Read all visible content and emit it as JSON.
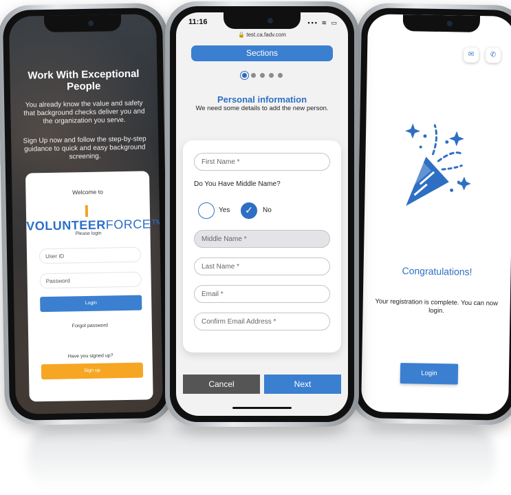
{
  "phone1": {
    "headline": "Work With Exceptional People",
    "para1": "You already know the value and safety that background checks deliver you and the organization you serve.",
    "para2": "Sign Up now and follow the step-by-step guidance to quick and easy background screening.",
    "welcome": "Welcome to",
    "logo_volunteer": "VOLUNTEER",
    "logo_force": "FORCE™",
    "please_login": "Please login",
    "userid_placeholder": "User ID",
    "password_placeholder": "Password",
    "login_label": "Login",
    "forgot_label": "Forgot password",
    "signed_up_q": "Have you signed up?",
    "signup_label": "Sign up"
  },
  "phone2": {
    "time": "11:16",
    "status_icons": "▪▪▪ ≋ ▭",
    "url": "🔒 test.ca.fadv.com",
    "sections_label": "Sections",
    "step_current": 1,
    "step_total": 5,
    "title": "Personal information",
    "subtitle": "We need some details to add the new person.",
    "first_name_placeholder": "First Name *",
    "middle_question": "Do You Have Middle Name?",
    "yes_label": "Yes",
    "no_label": "No",
    "middle_name_placeholder": "Middle Name *",
    "last_name_placeholder": "Last Name *",
    "email_placeholder": "Email *",
    "confirm_email_placeholder": "Confirm Email Address *",
    "cancel_label": "Cancel",
    "next_label": "Next"
  },
  "phone3": {
    "mail_icon": "✉",
    "phone_icon": "✆",
    "congrats": "Congratulations!",
    "message": "Your registration is complete. You can now login.",
    "login_label": "Login"
  },
  "colors": {
    "brand_blue": "#3b7fd0",
    "brand_orange": "#f6a623",
    "cancel_gray": "#555555"
  }
}
